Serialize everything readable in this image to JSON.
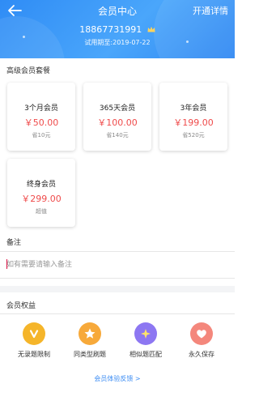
{
  "header": {
    "title": "会员中心",
    "action": "开通详情",
    "phone": "18867731991",
    "trial": "试用期至:2019-07-22"
  },
  "packages": {
    "section_title": "高级会员套餐",
    "items": [
      {
        "name": "3个月会员",
        "price": "￥50.00",
        "note": "省10元"
      },
      {
        "name": "365天会员",
        "price": "￥100.00",
        "note": "省140元"
      },
      {
        "name": "3年会员",
        "price": "￥199.00",
        "note": "省520元"
      },
      {
        "name": "终身会员",
        "price": "￥299.00",
        "note": "超值"
      }
    ]
  },
  "remark": {
    "section_title": "备注",
    "placeholder": "如有需要请输入备注"
  },
  "benefits": {
    "section_title": "会员权益",
    "items": [
      {
        "label": "无录题限制",
        "icon": "v-badge-icon",
        "color": "#f5b52a"
      },
      {
        "label": "同类型刷题",
        "icon": "star-icon",
        "color": "#f7a93a"
      },
      {
        "label": "相似题匹配",
        "icon": "sparkle-icon",
        "color": "#8d77f2"
      },
      {
        "label": "永久保存",
        "icon": "heart-icon",
        "color": "#f4877c"
      }
    ]
  },
  "footer": {
    "feedback_link": "会员体验反馈 >"
  },
  "colors": {
    "header_blue": "#2f8cf5",
    "price_red": "#ef4b4b",
    "link_blue": "#3d8df3"
  }
}
